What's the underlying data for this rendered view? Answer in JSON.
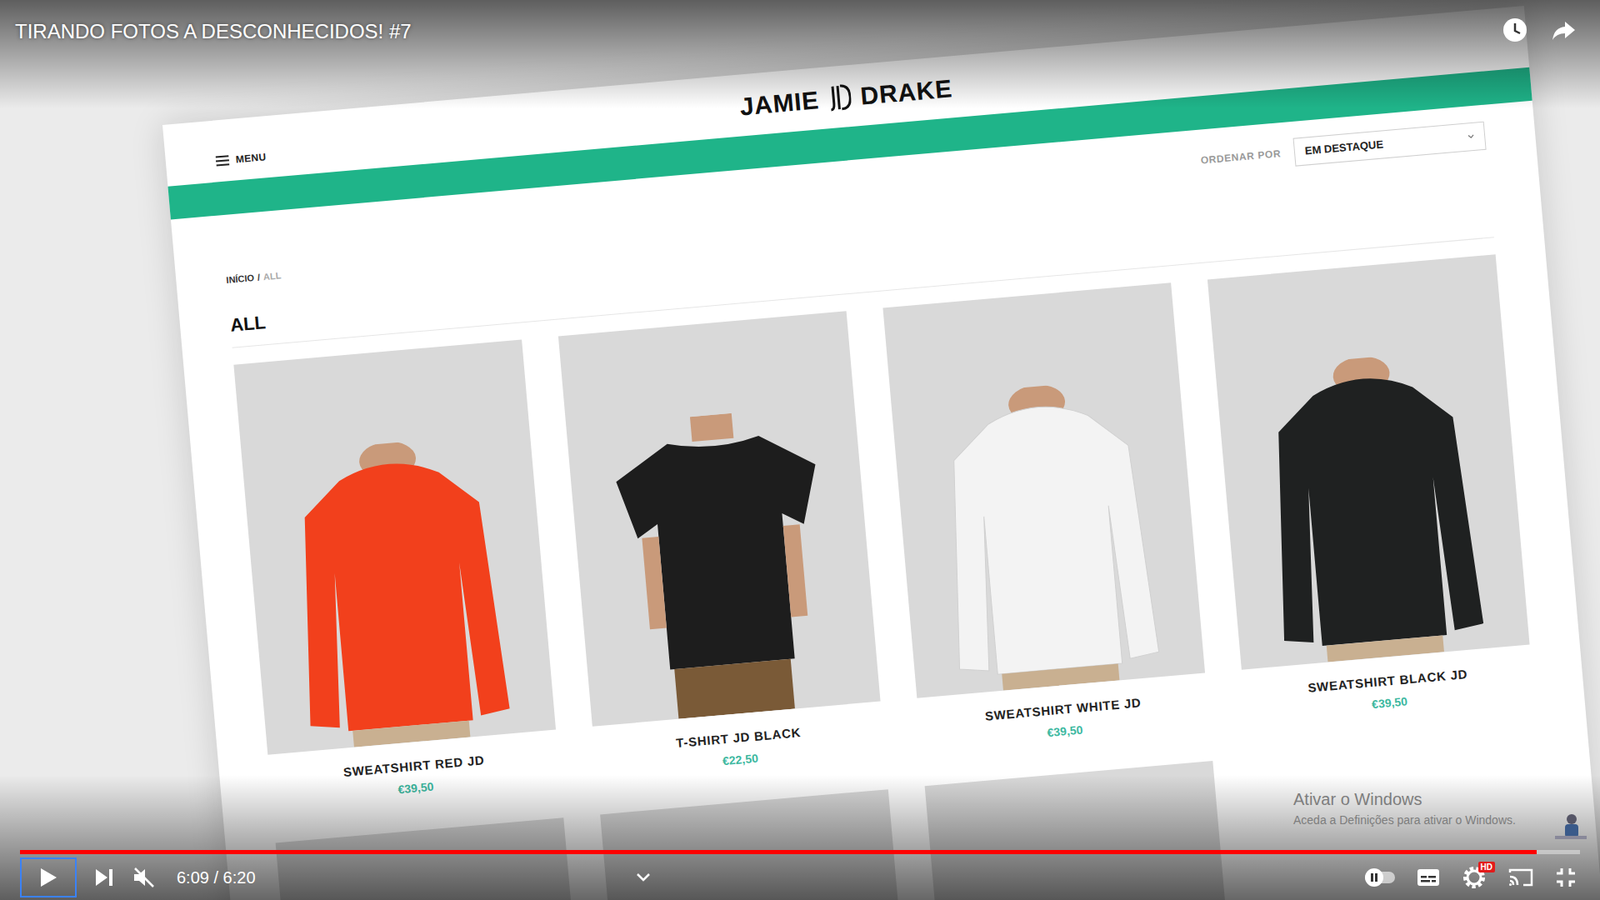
{
  "video": {
    "title": "TIRANDO FOTOS A DESCONHECIDOS! #7",
    "time": "6:09 / 6:20",
    "progress": 0.972,
    "muted": true,
    "autoplay_on": false,
    "hd_badge": "HD"
  },
  "site": {
    "logo_left": "JAMIE",
    "logo_right": "DRAKE",
    "menu": "MENU",
    "sort_label": "ORDENAR POR",
    "sort_value": "EM DESTAQUE",
    "breadcrumb": {
      "home": "INÍCIO",
      "separator": "/",
      "current": "ALL"
    },
    "heading": "ALL",
    "products": [
      {
        "name": "SWEATSHIRT RED JD",
        "price": "€39,50",
        "kind": "hoodie",
        "color": "#f2401c"
      },
      {
        "name": "T-SHIRT JD BLACK",
        "price": "€22,50",
        "kind": "tshirt",
        "color": "#1d1d1d"
      },
      {
        "name": "SWEATSHIRT WHITE JD",
        "price": "€39,50",
        "kind": "hoodie",
        "color": "#f3f3f3"
      },
      {
        "name": "SWEATSHIRT BLACK JD",
        "price": "€39,50",
        "kind": "hoodie",
        "color": "#1f2121"
      }
    ]
  },
  "watermark": {
    "title": "Ativar o Windows",
    "subtitle": "Aceda a Definições para ativar o Windows."
  }
}
